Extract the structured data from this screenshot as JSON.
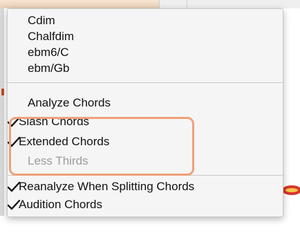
{
  "menu": {
    "items": [
      {
        "label": "Cdim",
        "checked": false,
        "enabled": true
      },
      {
        "label": "Chalfdim",
        "checked": false,
        "enabled": true
      },
      {
        "label": "ebm6/C",
        "checked": false,
        "enabled": true
      },
      {
        "label": "ebm/Gb",
        "checked": false,
        "enabled": true
      },
      {
        "label": "Analyze Chords",
        "checked": false,
        "enabled": true
      },
      {
        "label": "Slash Chords",
        "checked": true,
        "enabled": true
      },
      {
        "label": "Extended Chords",
        "checked": true,
        "enabled": true
      },
      {
        "label": "Less Thirds",
        "checked": false,
        "enabled": false
      },
      {
        "label": "Reanalyze When Splitting Chords",
        "checked": true,
        "enabled": true
      },
      {
        "label": "Audition Chords",
        "checked": true,
        "enabled": true
      }
    ]
  },
  "icons": {
    "check": "checkmark-icon"
  },
  "colors": {
    "highlight": "#f0a079",
    "disabled_text": "#9b9b9b"
  }
}
